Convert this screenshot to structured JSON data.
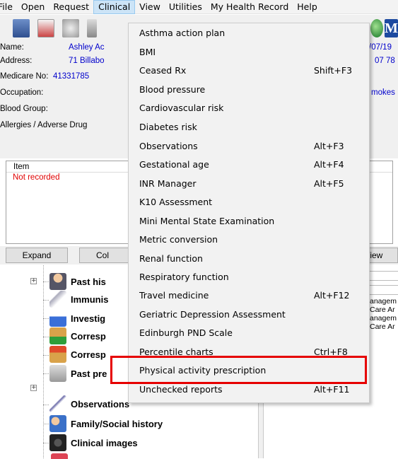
{
  "menubar": {
    "items": [
      "File",
      "Open",
      "Request",
      "Clinical",
      "View",
      "Utilities",
      "My Health Record",
      "Help"
    ],
    "active_index": 3
  },
  "patient": {
    "name_label": "Name:",
    "name_value": "Ashley Ac",
    "dob_partial": "/07/19",
    "address_label": "Address:",
    "address_value": "71 Billabo",
    "phone_partial": "07 78",
    "medicare_label": "Medicare No:",
    "medicare_value": "41331785",
    "occupation_label": "Occupation:",
    "smokes_partial": "mokes",
    "bloodgroup_label": "Blood Group:",
    "allergies_label": "Allergies / Adverse Drug"
  },
  "list": {
    "column_header": "Item",
    "first_cell": "Not recorded"
  },
  "buttons": {
    "expand": "Expand",
    "collapse_partial": "Col",
    "view_partial": "/iew"
  },
  "tree": {
    "items": [
      {
        "label": "Past his"
      },
      {
        "label": "Immunis"
      },
      {
        "label": "Investig"
      },
      {
        "label": "Corresp"
      },
      {
        "label": "Corresp"
      },
      {
        "label": "Past pre"
      },
      {
        "label": "Observations"
      },
      {
        "label": "Family/Social history"
      },
      {
        "label": "Clinical images"
      }
    ]
  },
  "rightpane": {
    "lines": [
      "anagem",
      "Care Ar",
      "anagem",
      "Care Ar"
    ]
  },
  "clinical_menu": {
    "items": [
      {
        "label": "Asthma action plan",
        "shortcut": ""
      },
      {
        "label": "BMI",
        "shortcut": ""
      },
      {
        "label": "Ceased Rx",
        "shortcut": "Shift+F3"
      },
      {
        "label": "Blood pressure",
        "shortcut": ""
      },
      {
        "label": "Cardiovascular risk",
        "shortcut": ""
      },
      {
        "label": "Diabetes risk",
        "shortcut": ""
      },
      {
        "label": "Observations",
        "shortcut": "Alt+F3"
      },
      {
        "label": "Gestational age",
        "shortcut": "Alt+F4"
      },
      {
        "label": "INR Manager",
        "shortcut": "Alt+F5"
      },
      {
        "label": "K10 Assessment",
        "shortcut": ""
      },
      {
        "label": "Mini Mental State Examination",
        "shortcut": ""
      },
      {
        "label": "Metric conversion",
        "shortcut": ""
      },
      {
        "label": "Renal function",
        "shortcut": ""
      },
      {
        "label": "Respiratory function",
        "shortcut": ""
      },
      {
        "label": "Travel medicine",
        "shortcut": "Alt+F12"
      },
      {
        "label": "Geriatric Depression Assessment",
        "shortcut": ""
      },
      {
        "label": "Edinburgh PND Scale",
        "shortcut": ""
      },
      {
        "label": "Percentile charts",
        "shortcut": "Ctrl+F8"
      },
      {
        "label": "Physical activity prescription",
        "shortcut": ""
      },
      {
        "label": "Unchecked reports",
        "shortcut": "Alt+F11"
      }
    ],
    "highlighted_index": 18
  },
  "colors": {
    "highlight_border": "#e60000",
    "link_blue": "#0000cc",
    "alert_red": "#e00000",
    "menu_active": "#cce4f7"
  }
}
